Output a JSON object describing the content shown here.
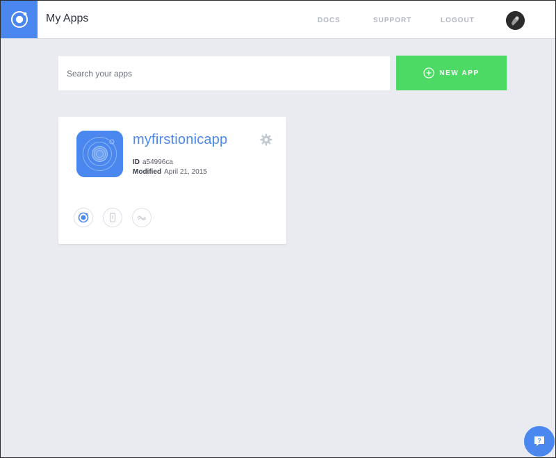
{
  "header": {
    "title": "My Apps",
    "nav": [
      "DOCS",
      "SUPPORT",
      "LOGOUT"
    ]
  },
  "search": {
    "placeholder": "Search your apps",
    "value": ""
  },
  "new_app_button": {
    "label": "NEW APP"
  },
  "apps": [
    {
      "name": "myfirstionicapp",
      "id_label": "ID",
      "id_value": "a54996ca",
      "modified_label": "Modified",
      "modified_value": "April 21, 2015"
    }
  ],
  "colors": {
    "brand_blue": "#4a87ee",
    "accent_green": "#4cd964",
    "background": "#e9ebf1"
  },
  "icons": [
    "ionic-logo-icon",
    "user-avatar",
    "add-circle-icon",
    "gear-icon",
    "ionic-view-icon",
    "device-icon",
    "deploy-icon",
    "help-chat-icon"
  ]
}
